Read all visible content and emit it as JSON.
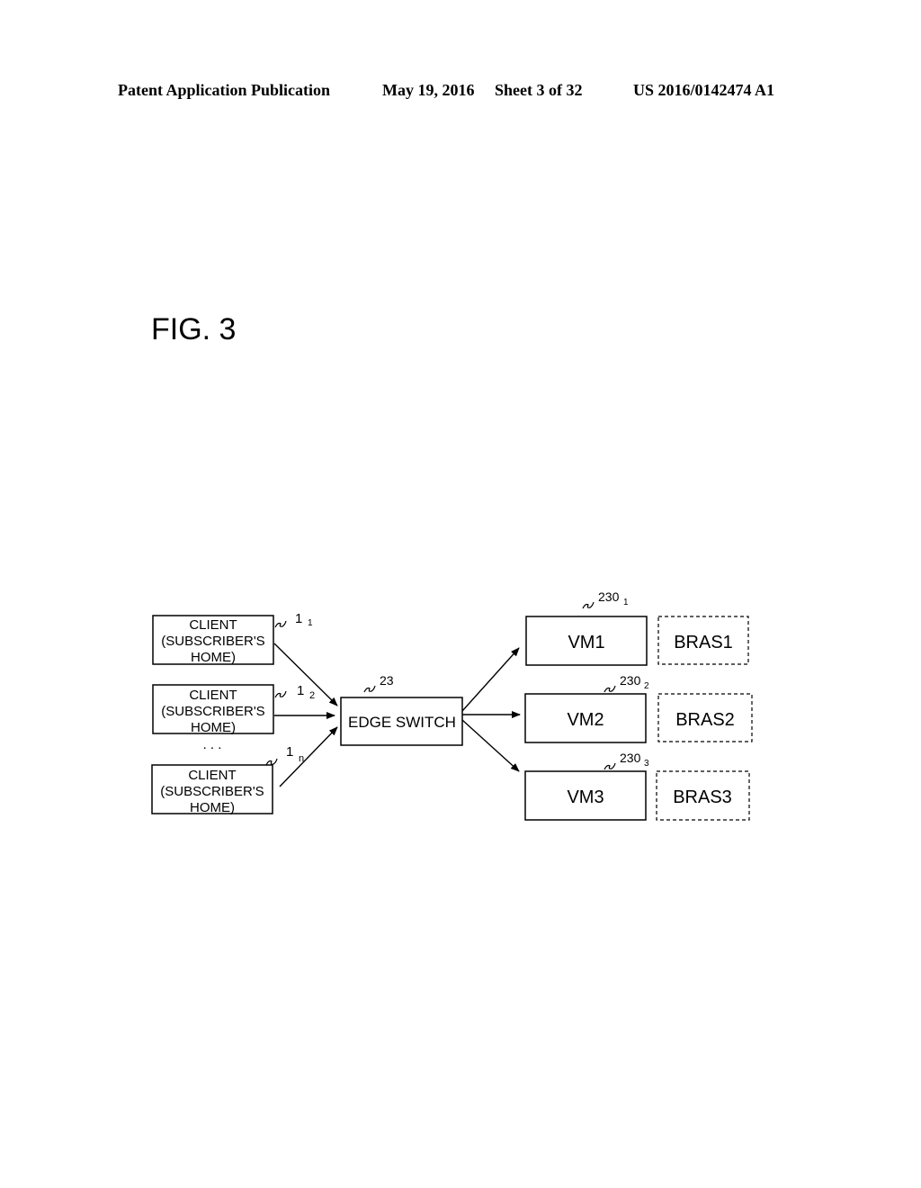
{
  "header": {
    "left": "Patent Application Publication",
    "date": "May 19, 2016",
    "sheet": "Sheet 3 of 32",
    "pub_number": "US 2016/0142474 A1"
  },
  "figure": {
    "label": "FIG. 3"
  },
  "diagram": {
    "clients": [
      {
        "lines": [
          "CLIENT",
          "(SUBSCRIBER'S",
          "HOME)"
        ],
        "ref": "1",
        "ref_sub": "1"
      },
      {
        "lines": [
          "CLIENT",
          "(SUBSCRIBER'S",
          "HOME)"
        ],
        "ref": "1",
        "ref_sub": "2"
      },
      {
        "lines": [
          "CLIENT",
          "(SUBSCRIBER'S",
          "HOME)"
        ],
        "ref": "1",
        "ref_sub": "n"
      }
    ],
    "ellipsis": ". . .",
    "edge_switch": {
      "label": "EDGE SWITCH",
      "ref": "23"
    },
    "vms": [
      {
        "label": "VM1",
        "ref": "230",
        "ref_sub": "1",
        "bras": "BRAS1"
      },
      {
        "label": "VM2",
        "ref": "230",
        "ref_sub": "2",
        "bras": "BRAS2"
      },
      {
        "label": "VM3",
        "ref": "230",
        "ref_sub": "3",
        "bras": "BRAS3"
      }
    ]
  }
}
